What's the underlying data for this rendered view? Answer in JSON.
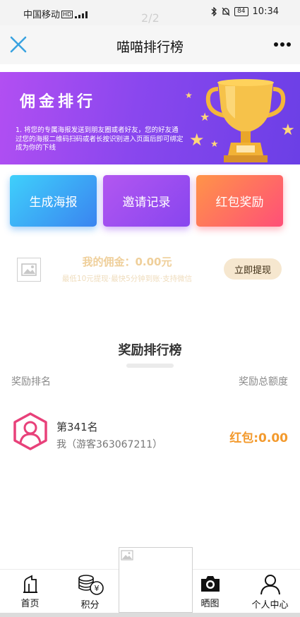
{
  "status_bar": {
    "carrier": "中国移动",
    "hd": "HD",
    "page_indicator": "2/2",
    "battery": "84",
    "time": "10:34"
  },
  "nav": {
    "title": "喵喵排行榜"
  },
  "banner": {
    "title": "佣金排行",
    "description": "1. 将您的专属海报发送到朋友圈或者好友，您的好友通过您的海报二维码扫码或者长按识别进入页面后即可绑定成为你的下线"
  },
  "actions": {
    "poster": "生成海报",
    "invite": "邀请记录",
    "reward": "红包奖励"
  },
  "commission": {
    "amount": "我的佣金：0.00元",
    "rule": "最低10元提现·最快5分钟到账·支持微信",
    "withdraw": "立即提现"
  },
  "ranking": {
    "heading": "奖励排行榜",
    "col_rank": "奖励排名",
    "col_total": "奖励总额度",
    "my_rank": "第341名",
    "my_user": "我（游客363067211）",
    "my_reward": "红包:0.00"
  },
  "tabs": {
    "home": "首页",
    "points": "积分",
    "share": "晒图",
    "profile": "个人中心"
  },
  "colors": {
    "accent_orange": "#f39a2d",
    "banner_purple": "#8a47ee",
    "avatar_pink": "#e8417a"
  }
}
